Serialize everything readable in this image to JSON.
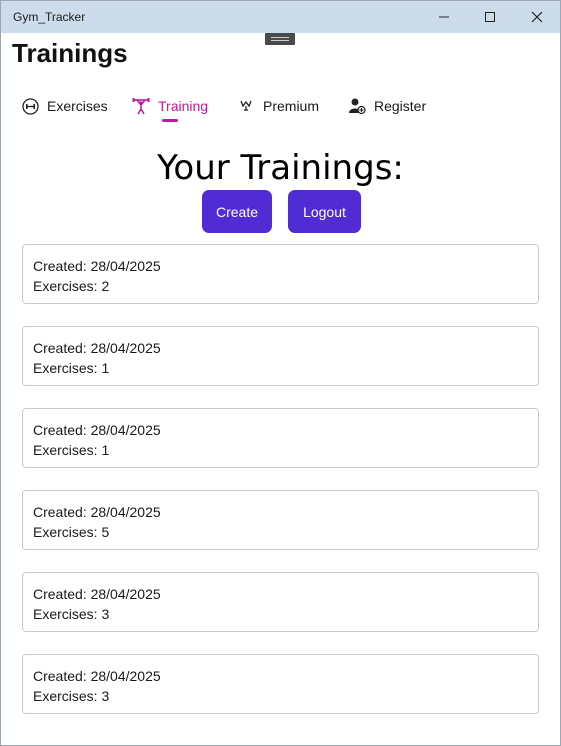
{
  "window": {
    "app_title": "Gym_Tracker"
  },
  "page": {
    "title": "Trainings"
  },
  "tabs": [
    {
      "label": "Exercises",
      "icon": "dumbbell-icon",
      "active": false
    },
    {
      "label": "Training",
      "icon": "weightlifter-icon",
      "active": true
    },
    {
      "label": "Premium",
      "icon": "trophy-icon",
      "active": false
    },
    {
      "label": "Register",
      "icon": "user-add-icon",
      "active": false
    }
  ],
  "main": {
    "heading": "Your Trainings:",
    "create_label": "Create",
    "logout_label": "Logout"
  },
  "trainings": [
    {
      "created": "Created: 28/04/2025",
      "exercises": "Exercises: 2"
    },
    {
      "created": "Created: 28/04/2025",
      "exercises": "Exercises: 1"
    },
    {
      "created": "Created: 28/04/2025",
      "exercises": "Exercises: 1"
    },
    {
      "created": "Created: 28/04/2025",
      "exercises": "Exercises: 5"
    },
    {
      "created": "Created: 28/04/2025",
      "exercises": "Exercises: 3"
    },
    {
      "created": "Created: 28/04/2025",
      "exercises": "Exercises: 3"
    }
  ],
  "colors": {
    "accent": "#512bd4",
    "active_tab": "#c2189b",
    "titlebar": "#cddcea"
  }
}
